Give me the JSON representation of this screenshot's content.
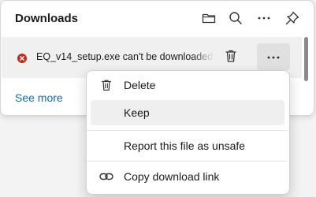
{
  "panel": {
    "title": "Downloads",
    "header_icons": [
      "folder-icon",
      "search-icon",
      "more-options-icon",
      "pin-icon"
    ],
    "see_more": "See more"
  },
  "download_item": {
    "filename": "EQ_v14_setup.exe can't be downloaded",
    "status_icon": "error-icon",
    "status_color": "#c42b1c"
  },
  "context_menu": {
    "items": [
      {
        "label": "Delete",
        "icon": "trash-icon"
      },
      {
        "label": "Keep",
        "icon": ""
      },
      {
        "label": "Report this file as unsafe",
        "icon": ""
      },
      {
        "label": "Copy download link",
        "icon": "link-icon"
      }
    ],
    "hovered": "Keep"
  },
  "colors": {
    "link": "#0f6cbd",
    "error": "#c42b1c"
  }
}
